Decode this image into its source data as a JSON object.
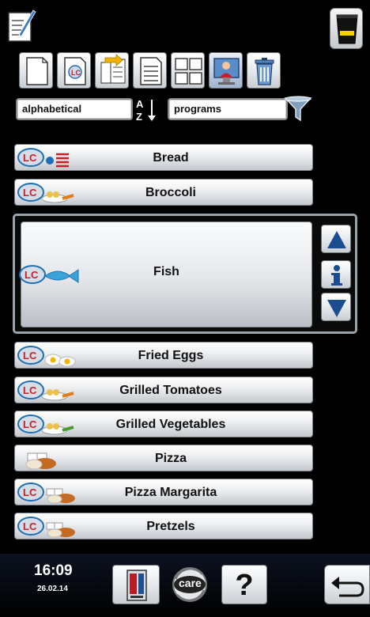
{
  "toolbar": {
    "icons": [
      "edit-icon",
      "new-program-icon",
      "new-lc-program-icon",
      "copy-icon",
      "list-icon",
      "grid-view-icon",
      "picture-view-icon",
      "trash-icon",
      "cup-icon"
    ]
  },
  "filters": {
    "sort_value": "alphabetical",
    "filter_value": "programs",
    "sort_icon": "sort-az-icon",
    "filter_icon": "funnel-icon"
  },
  "programs": [
    {
      "label": "Bread",
      "icon": "lc-bread-icon"
    },
    {
      "label": "Broccoli",
      "icon": "lc-vegetables-icon"
    },
    {
      "label": "Fish",
      "icon": "lc-fish-icon",
      "selected": true
    },
    {
      "label": "Fried Eggs",
      "icon": "lc-eggs-icon"
    },
    {
      "label": "Grilled Tomatoes",
      "icon": "lc-vegetables-icon"
    },
    {
      "label": "Grilled Vegetables",
      "icon": "lc-vegetables-icon"
    },
    {
      "label": "Pizza",
      "icon": "bakery-icon"
    },
    {
      "label": "Pizza Margarita",
      "icon": "lc-bakery-icon"
    },
    {
      "label": "Pretzels",
      "icon": "lc-bakery-icon"
    }
  ],
  "selection_controls": [
    "arrow-up-icon",
    "info-icon",
    "arrow-down-icon"
  ],
  "status": {
    "time": "16:09",
    "date": "26.02.14"
  },
  "bottom": {
    "care_label": "care",
    "help_label": "?"
  },
  "colors": {
    "background": "#000000",
    "lc_red": "#c8202a",
    "lc_blue": "#1f6fb5",
    "cup_yellow": "#f5d400"
  }
}
